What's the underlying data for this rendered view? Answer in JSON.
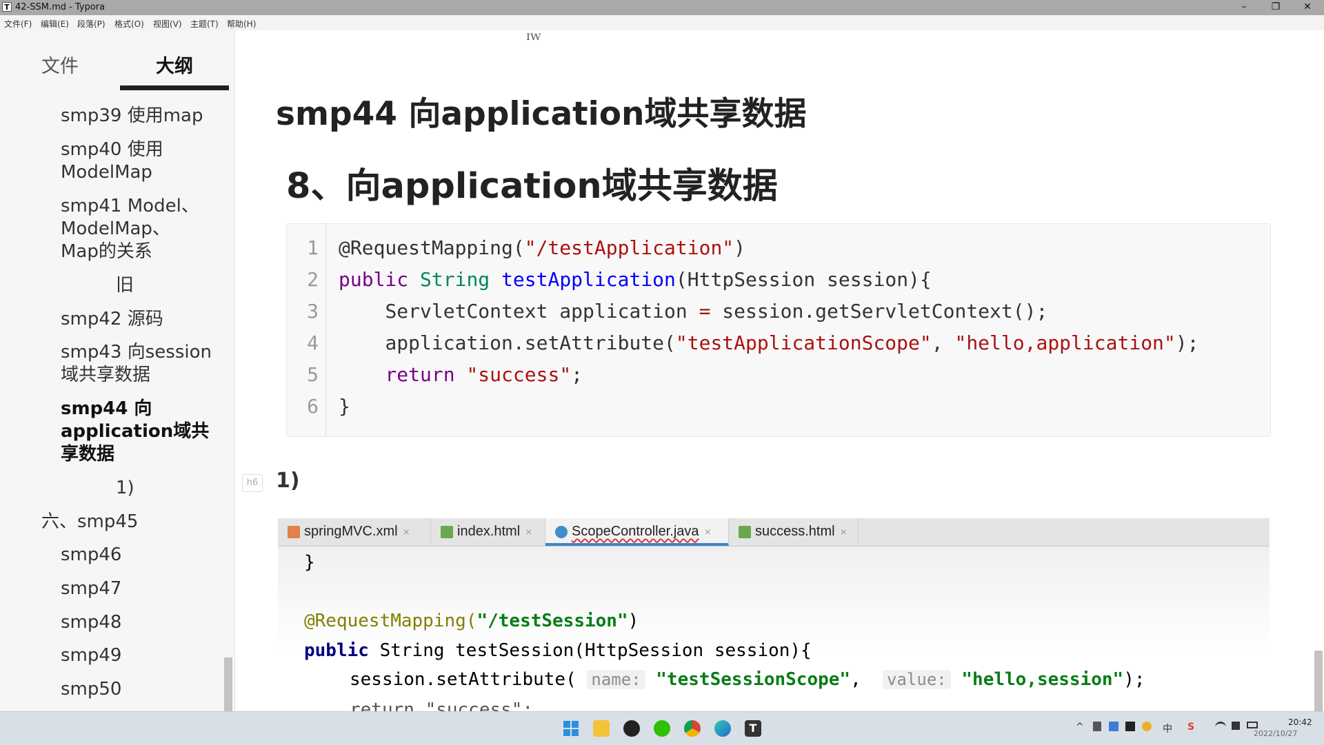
{
  "window": {
    "title": "42-SSM.md - Typora",
    "app_icon": "T",
    "controls": {
      "minimize": "–",
      "maximize": "❐",
      "close": "✕"
    }
  },
  "menu": [
    "文件(F)",
    "编辑(E)",
    "段落(P)",
    "格式(O)",
    "视图(V)",
    "主题(T)",
    "帮助(H)"
  ],
  "sidebar": {
    "tabs": {
      "files": "文件",
      "outline": "大纲"
    },
    "outline": [
      "smp39 使用map",
      "smp40 使用",
      "ModelMap",
      "smp41 Model、",
      "ModelMap、",
      "Map的关系",
      "旧",
      "smp42 源码",
      "smp43 向session",
      "域共享数据",
      "smp44 向",
      "application域共",
      "享数据",
      "1)",
      "六、smp45",
      "smp46",
      "smp47",
      "smp48",
      "smp49",
      "smp50"
    ]
  },
  "editor": {
    "cursor_mark": "ᴵᵂ",
    "h1": "smp44 向application域共享数据",
    "h2": "8、向application域共享数据",
    "h6_badge": "h6",
    "h6": "1)",
    "code": {
      "line_numbers": [
        "1",
        "2",
        "3",
        "4",
        "5",
        "6"
      ],
      "l1": {
        "ann": "@RequestMapping(",
        "str": "\"/testApplication\"",
        "end": ")"
      },
      "l2": {
        "kw": "public",
        "type": "String",
        "fn": "testApplication",
        "rest": "(HttpSession session){"
      },
      "l3": {
        "a": "ServletContext application ",
        "op": "=",
        "b": " session.getServletContext();"
      },
      "l4": {
        "a": "application.setAttribute(",
        "s1": "\"testApplicationScope\"",
        "b": ", ",
        "s2": "\"hello,application\"",
        "c": ");"
      },
      "l5": {
        "kw": "return",
        "str": "\"success\"",
        "end": ";"
      },
      "l6": "}"
    },
    "ide": {
      "tabs": [
        {
          "label": "springMVC.xml",
          "color": "#e0824a"
        },
        {
          "label": "index.html",
          "color": "#6aa84f"
        },
        {
          "label": "ScopeController.java",
          "color": "#3d8fc9"
        },
        {
          "label": "success.html",
          "color": "#6aa84f"
        }
      ],
      "tab_close": "×",
      "line_brace": "}",
      "ann_prefix": "@RequestMapping(",
      "ann_str": "\"/testSession\"",
      "ann_end": ")",
      "sig_kw": "public",
      "sig_rest": " String testSession(HttpSession session){",
      "set_call": "session.setAttribute(",
      "hint_name": "name:",
      "str_scope": "\"testSessionScope\"",
      "comma": ",",
      "hint_value": "value:",
      "str_hello": "\"hello,session\"",
      "set_end": ");",
      "partial_return": "return \"success\";"
    }
  },
  "taskbar": {
    "tray_lang": "中",
    "tray_ime": "S",
    "time": "20:42",
    "date": "2022/10/27"
  }
}
